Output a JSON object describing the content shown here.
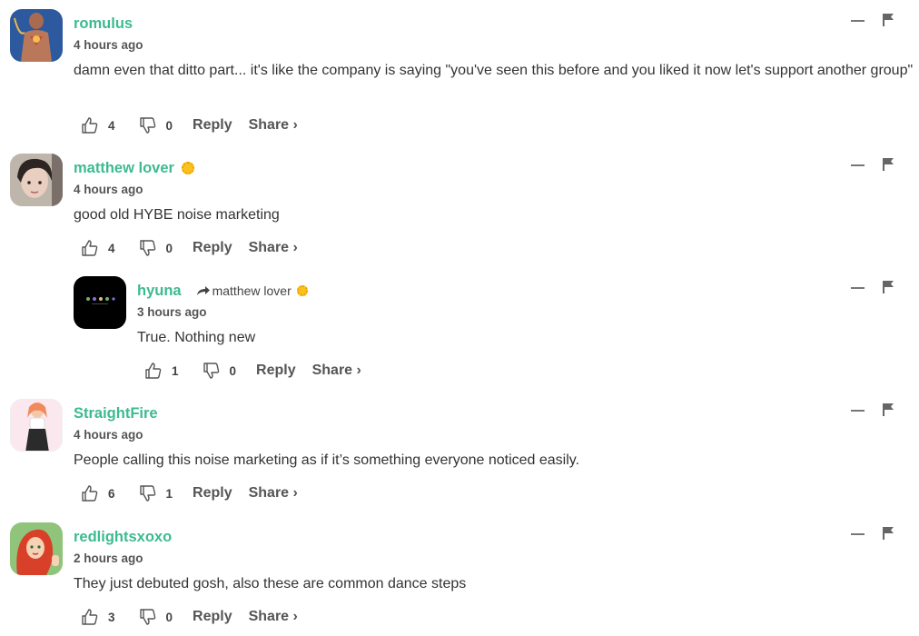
{
  "share_label": "Share ›",
  "reply_label": "Reply",
  "comments": [
    {
      "username": "romulus",
      "time": "4 hours ago",
      "text": "damn even that ditto part... it's like the company is saying \"you've seen this before and you liked it now let's support another group\"",
      "likes": "4",
      "dislikes": "0",
      "badge": false,
      "avatar_colors": [
        "#2d5a9e",
        "#c9463d"
      ]
    },
    {
      "username": "matthew lover",
      "time": "4 hours ago",
      "text": "good old HYBE noise marketing",
      "likes": "4",
      "dislikes": "0",
      "badge": true,
      "avatar_colors": [
        "#bfb6ab",
        "#2d2521"
      ]
    },
    {
      "username": "hyuna",
      "reply_to": "matthew lover",
      "time": "3 hours ago",
      "text": "True. Nothing new",
      "likes": "1",
      "dislikes": "0",
      "badge": false,
      "avatar_colors": [
        "#000000",
        "#6fb26a"
      ]
    },
    {
      "username": "StraightFire",
      "time": "4 hours ago",
      "text": "People calling this noise marketing as if it’s something everyone noticed easily.",
      "likes": "6",
      "dislikes": "1",
      "badge": false,
      "avatar_colors": [
        "#fbe8ee",
        "#f08a5d"
      ]
    },
    {
      "username": "redlightsxoxo",
      "time": "2 hours ago",
      "text": "They just debuted gosh, also these are common dance steps",
      "likes": "3",
      "dislikes": "0",
      "badge": false,
      "avatar_colors": [
        "#8fc47a",
        "#d8402a"
      ]
    }
  ],
  "colors": {
    "username": "#3dba91",
    "badge": "#f9c21d"
  }
}
